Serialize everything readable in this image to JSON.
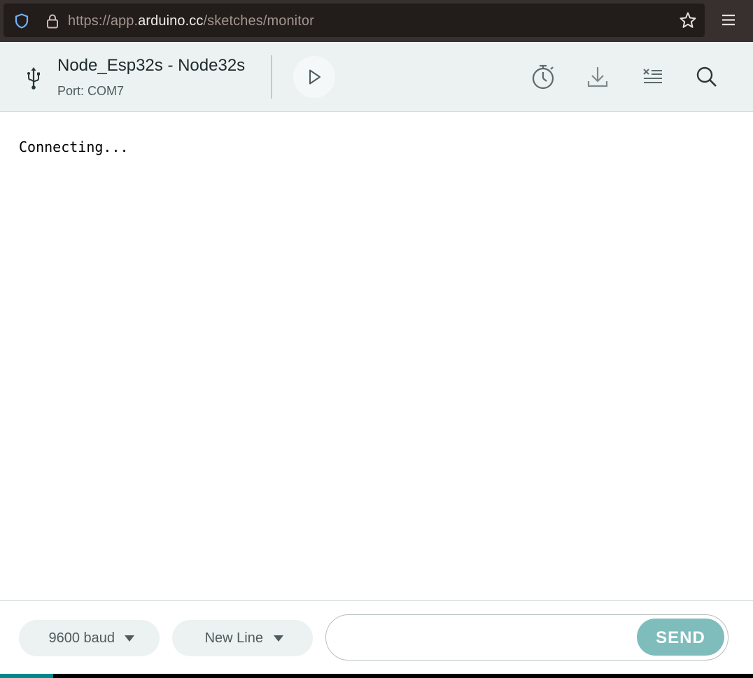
{
  "browser": {
    "url_prefix": "https://app.",
    "url_domain": "arduino.cc",
    "url_path": "/sketches/monitor",
    "icons": [
      "shield-icon",
      "lock-icon",
      "bookmark-star-icon",
      "hamburger-menu-icon"
    ]
  },
  "header": {
    "board_name": "Node_Esp32s - Node32s",
    "port_label": "Port: COM7",
    "icons": [
      "usb-icon",
      "play-icon",
      "timer-icon",
      "download-icon",
      "clear-output-icon",
      "search-icon"
    ]
  },
  "monitor": {
    "output": "Connecting..."
  },
  "footer": {
    "baud_label": "9600 baud",
    "line_ending_label": "New Line",
    "message_value": "",
    "send_label": "SEND"
  },
  "colors": {
    "accent_teal": "#00878a",
    "send_button": "#7fbdbc",
    "header_bg": "#ecf1f1",
    "browser_bar": "#38302e"
  }
}
